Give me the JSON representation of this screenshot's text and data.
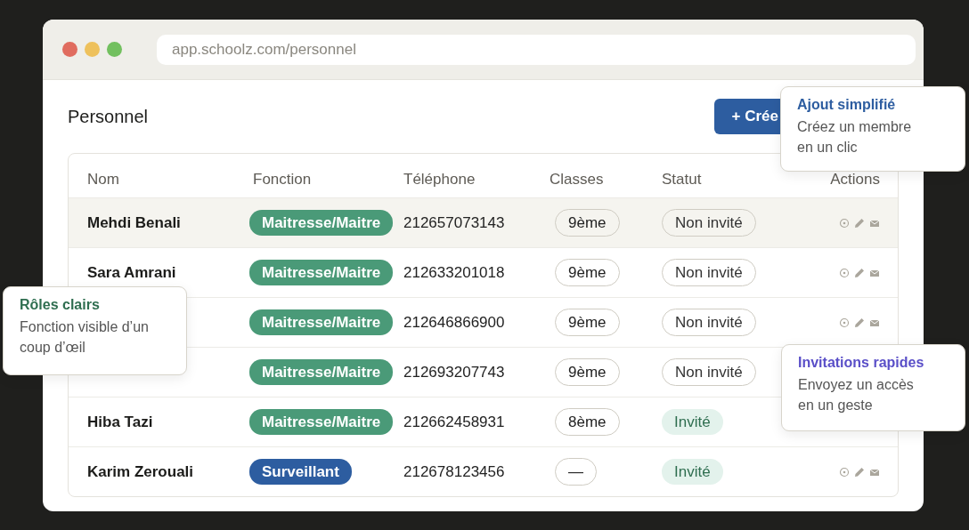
{
  "browser": {
    "url": "app.schoolz.com/personnel"
  },
  "page": {
    "title": "Personnel",
    "create_button": "+ Crée"
  },
  "table": {
    "columns": [
      "Nom",
      "Fonction",
      "Téléphone",
      "Classes",
      "Statut",
      "Actions"
    ],
    "rows": [
      {
        "name": "Mehdi Benali",
        "role": "Maitresse/Maitre",
        "color": "#4a9a78",
        "phone": "212657073143",
        "classes": "9ème",
        "status": "Non invité",
        "invited": false,
        "actions": true,
        "selected": true
      },
      {
        "name": "Sara Amrani",
        "role": "Maitresse/Maitre",
        "color": "#4a9a78",
        "phone": "212633201018",
        "classes": "9ème",
        "status": "Non invité",
        "invited": false,
        "actions": true,
        "selected": false
      },
      {
        "role": "Maitresse/Maitre",
        "color": "#4a9a78",
        "phone": "212646866900",
        "classes": "9ème",
        "status": "Non invité",
        "invited": false,
        "actions": true,
        "selected": false
      },
      {
        "role": "Maitresse/Maitre",
        "color": "#4a9a78",
        "phone": "212693207743",
        "classes": "9ème",
        "status": "Non invité",
        "invited": false,
        "actions": false,
        "selected": false
      },
      {
        "name": "Hiba Tazi",
        "role": "Maitresse/Maitre",
        "color": "#4a9a78",
        "phone": "212662458931",
        "classes": "8ème",
        "status": "Invité",
        "invited": true,
        "actions": false,
        "selected": false
      },
      {
        "name": "Karim Zerouali",
        "role": "Surveillant",
        "color": "#2d5da0",
        "phone": "212678123456",
        "classes": "—",
        "status": "Invité",
        "invited": true,
        "actions": true,
        "selected": false
      }
    ]
  },
  "callouts": [
    {
      "title": "Ajout simplifié",
      "text": "Créez un membre en un clic",
      "color": "#2d5da0"
    },
    {
      "title": "Rôles clairs",
      "text": "Fonction visible d’un coup d’œil",
      "color": "#2f6e50"
    },
    {
      "title": "Invitations rapides",
      "text": "Envoyez un accès en un geste",
      "color": "#5a4fc8"
    }
  ]
}
